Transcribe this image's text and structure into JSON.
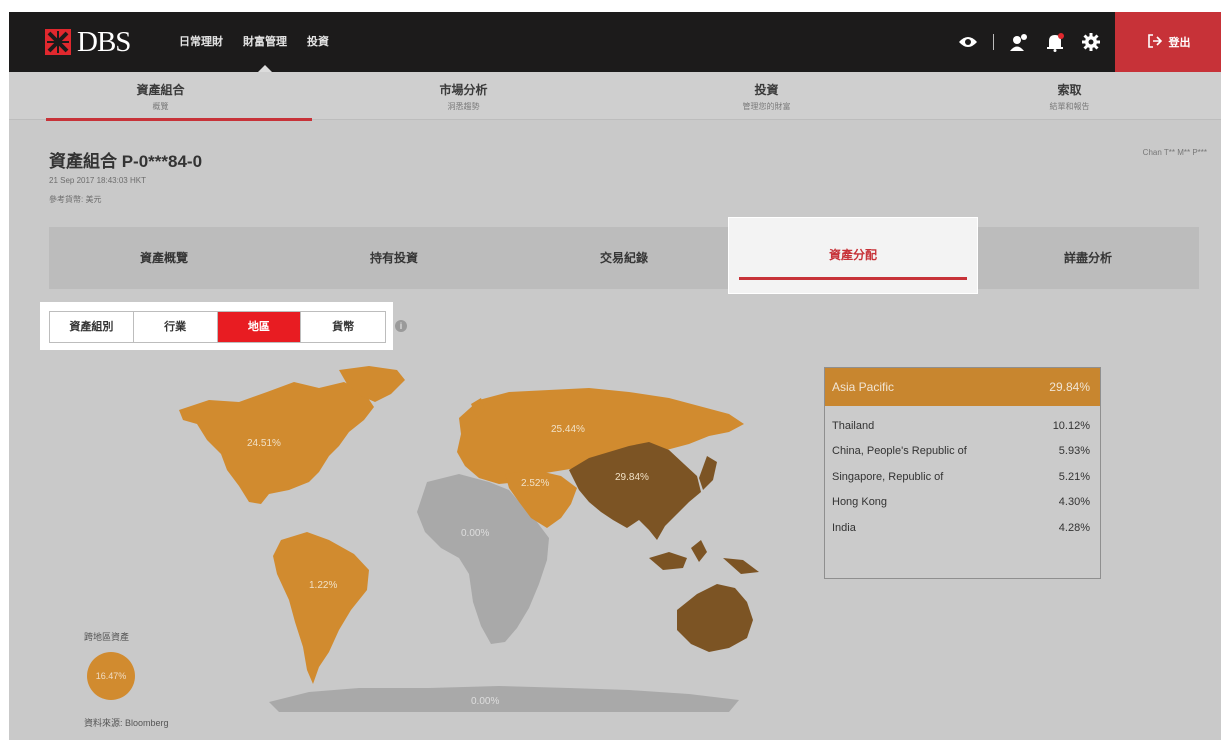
{
  "brand": {
    "name": "DBS",
    "accent": "#c73238",
    "map_color": "#d18b2f",
    "map_highlight": "#7c5424",
    "map_zero": "#a9a9a9"
  },
  "topnav": {
    "items": [
      "日常理財",
      "財富管理",
      "投資"
    ],
    "active_index": 1
  },
  "topicons": [
    "eye-icon",
    "user-chat-icon",
    "notification-bell-icon",
    "gear-icon"
  ],
  "logout": {
    "label": "登出",
    "icon": "logout-icon"
  },
  "subnav": {
    "items": [
      {
        "label": "資產組合",
        "sub": "概覽"
      },
      {
        "label": "市場分析",
        "sub": "洞悉趨勢"
      },
      {
        "label": "投資",
        "sub": "管理您的財富"
      },
      {
        "label": "索取",
        "sub": "結單和報告"
      }
    ],
    "active_index": 0
  },
  "portfolio": {
    "title": "資產組合 P-0***84-0",
    "date": "21 Sep 2017 18:43:03 HKT",
    "currency": "參考貨幣: 美元",
    "user": "Chan T** M** P***"
  },
  "tabs": {
    "items": [
      "資產概覽",
      "持有投資",
      "交易紀錄",
      "資產分配",
      "詳盡分析"
    ],
    "active_index": 3
  },
  "filters": {
    "items": [
      "資產組別",
      "行業",
      "地區",
      "貨幣"
    ],
    "active_index": 2,
    "info_icon": "info-icon"
  },
  "map": {
    "labels": {
      "north_america": "24.51%",
      "south_america": "1.22%",
      "europe": "25.44%",
      "middle_east": "2.52%",
      "asia_pacific": "29.84%",
      "africa": "0.00%",
      "antarctica": "0.00%"
    }
  },
  "region_panel": {
    "title": "Asia Pacific",
    "total": "29.84%",
    "rows": [
      {
        "name": "Thailand",
        "value": "10.12%"
      },
      {
        "name": "China, People's Republic of",
        "value": "5.93%"
      },
      {
        "name": "Singapore, Republic of",
        "value": "5.21%"
      },
      {
        "name": "Hong Kong",
        "value": "4.30%"
      },
      {
        "name": "India",
        "value": "4.28%"
      }
    ]
  },
  "legend": {
    "label": "跨地區資產",
    "value": "16.47%"
  },
  "source": "資料來源: Bloomberg"
}
